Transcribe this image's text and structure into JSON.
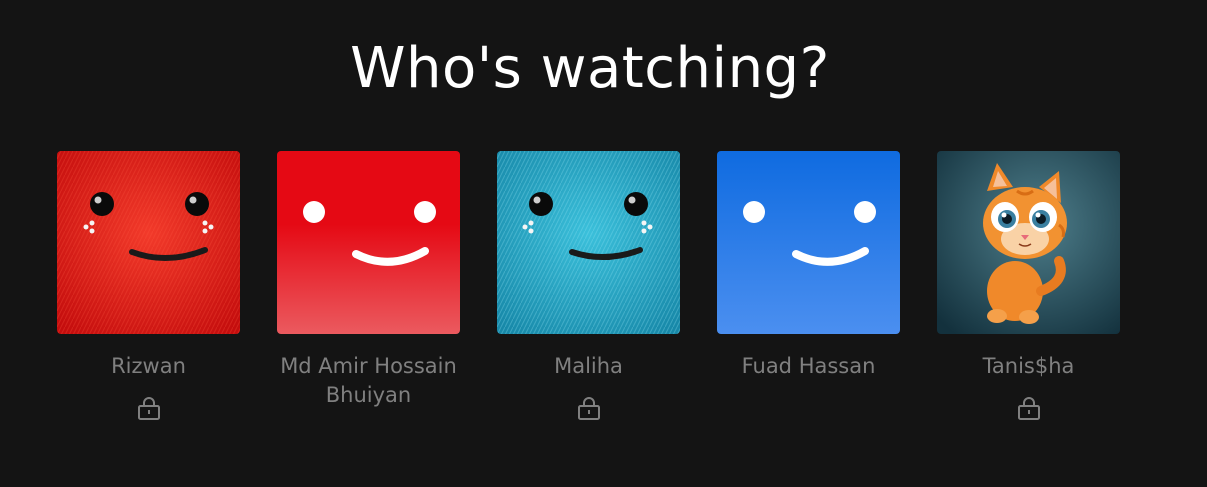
{
  "title": "Who's watching?",
  "profiles": [
    {
      "name": "Rizwan",
      "avatar": "red-fur-smiley-avatar",
      "locked": true
    },
    {
      "name": "Md Amir Hossain Bhuiyan",
      "avatar": "red-smiley-avatar",
      "locked": false
    },
    {
      "name": "Maliha",
      "avatar": "teal-fur-smiley-avatar",
      "locked": true
    },
    {
      "name": "Fuad Hassan",
      "avatar": "blue-smiley-avatar",
      "locked": false
    },
    {
      "name": "Tanis$ha",
      "avatar": "cartoon-cat-avatar",
      "locked": true
    }
  ],
  "icons": {
    "lock": "lock-icon"
  },
  "colors": {
    "background": "#141414",
    "title": "#ffffff",
    "name": "#808080",
    "red": "#e50914",
    "blue": "#1a73e8",
    "teal": "#1fa6c4"
  }
}
